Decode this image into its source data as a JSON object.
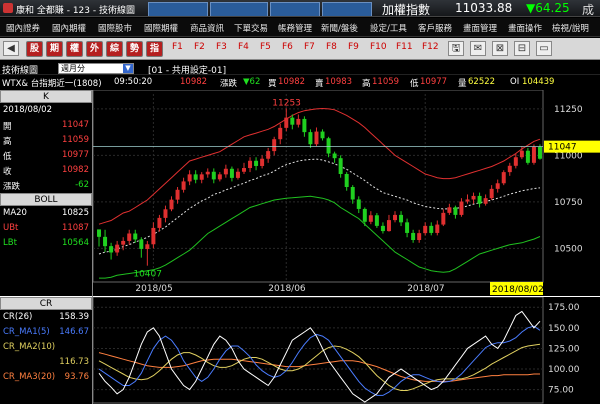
{
  "titlebar": {
    "app_title": "康和 全都賺 - 123 - 技術線圖",
    "tabs": [
      "",
      "",
      "",
      ""
    ],
    "index_name": "加權指數",
    "index_value": "11033.88",
    "index_change": "▼64.25",
    "more": "成交"
  },
  "menu": [
    "國內證券",
    "國內期權",
    "國際股市",
    "國際期權",
    "商品資訊",
    "下單交易",
    "帳務管理",
    "新聞/盤後",
    "設定/工具",
    "客戶服務",
    "畫面管理",
    "畫面操作",
    "檢視/說明"
  ],
  "toolbar": {
    "buttons": [
      "股",
      "期",
      "權",
      "外",
      "綜",
      "勢",
      "指"
    ],
    "functions": [
      "F1",
      "F2",
      "F3",
      "F4",
      "F5",
      "F6",
      "F7",
      "F8",
      "F9",
      "F10",
      "F11",
      "F12"
    ],
    "icons": [
      "🖫",
      "✉",
      "⊠",
      "⊟",
      "▭"
    ]
  },
  "chart_bar": {
    "title": "技術線圖",
    "period": "週月分",
    "setting": "[01 - 共用設定-01]"
  },
  "info": {
    "symbol": "WTX&  台指期近一(1808)",
    "time": "09:50:20",
    "last": "10982",
    "change_label": "漲跌",
    "change": "▼62",
    "open_label": "買",
    "open": "10982",
    "bid_label": "賣",
    "bid": "10983",
    "high_label": "高",
    "high": "11059",
    "low_label": "低",
    "low": "10977",
    "vol_label": "量",
    "vol": "62522",
    "oi_label": "OI",
    "oi": "104439"
  },
  "k_panel": {
    "header": "K",
    "date": "2018/08/02",
    "rows": [
      {
        "k": "開",
        "v": "11047"
      },
      {
        "k": "高",
        "v": "11059"
      },
      {
        "k": "低",
        "v": "10977"
      },
      {
        "k": "收",
        "v": "10982"
      },
      {
        "k": "漲跌",
        "v": "-62"
      }
    ]
  },
  "boll_panel": {
    "header": "BOLL",
    "rows": [
      {
        "k": "MA20",
        "v": "10825"
      },
      {
        "k": "UBt",
        "v": "11087"
      },
      {
        "k": "LBt",
        "v": "10564"
      }
    ]
  },
  "cr_panel": {
    "header": "CR",
    "rows": [
      {
        "k": "CR(26)",
        "v": "158.39"
      },
      {
        "k": "CR_MA1(5)",
        "v": "146.67"
      },
      {
        "k": "CR_MA2(10)",
        "v": "116.73"
      },
      {
        "k": "CR_MA3(20)",
        "v": "93.76"
      }
    ]
  },
  "colors": {
    "up": "#e03030",
    "down": "#20d020",
    "upper": "#e03030",
    "lower": "#20c020",
    "ma": "#e0e0e0",
    "cr": "#ffffff",
    "cr_ma1": "#4a7cff",
    "cr_ma2": "#e0d060",
    "cr_ma3": "#ff8040",
    "grid": "#333"
  },
  "chart_data": [
    {
      "type": "candlestick",
      "title": "WTX&",
      "yticks": [
        11250,
        11000,
        10750,
        10500
      ],
      "ylim": [
        10330,
        11330
      ],
      "xlabels": [
        "2018/05",
        "2018/06",
        "2018/07"
      ],
      "cursor_date": "2018/08/02",
      "last_value": "11047",
      "max_label": "11253",
      "min_label": "10407",
      "candles": [
        [
          10602,
          10562,
          10590,
          10510
        ],
        [
          10562,
          10512,
          10600,
          10480
        ],
        [
          10512,
          10478,
          10530,
          10440
        ],
        [
          10478,
          10520,
          10540,
          10460
        ],
        [
          10520,
          10540,
          10560,
          10490
        ],
        [
          10540,
          10580,
          10600,
          10520
        ],
        [
          10580,
          10548,
          10600,
          10530
        ],
        [
          10548,
          10497,
          10560,
          10450
        ],
        [
          10497,
          10522,
          10540,
          10407
        ],
        [
          10522,
          10610,
          10640,
          10500
        ],
        [
          10610,
          10664,
          10680,
          10590
        ],
        [
          10664,
          10710,
          10730,
          10640
        ],
        [
          10710,
          10762,
          10780,
          10700
        ],
        [
          10762,
          10815,
          10830,
          10740
        ],
        [
          10815,
          10860,
          10880,
          10800
        ],
        [
          10860,
          10898,
          10920,
          10840
        ],
        [
          10898,
          10869,
          10920,
          10850
        ],
        [
          10869,
          10898,
          10910,
          10850
        ],
        [
          10898,
          10912,
          10930,
          10880
        ],
        [
          10912,
          10871,
          10930,
          10850
        ],
        [
          10871,
          10898,
          10910,
          10860
        ],
        [
          10898,
          10928,
          10950,
          10880
        ],
        [
          10928,
          10879,
          10940,
          10860
        ],
        [
          10879,
          10912,
          10930,
          10870
        ],
        [
          10912,
          10932,
          10960,
          10900
        ],
        [
          10932,
          10971,
          10990,
          10910
        ],
        [
          10971,
          10943,
          10990,
          10920
        ],
        [
          10943,
          10982,
          11000,
          10930
        ],
        [
          10982,
          11023,
          11040,
          10960
        ],
        [
          11023,
          11087,
          11100,
          11000
        ],
        [
          11087,
          11148,
          11170,
          11060
        ],
        [
          11148,
          11203,
          11253,
          11130
        ],
        [
          11203,
          11165,
          11220,
          11140
        ],
        [
          11165,
          11196,
          11220,
          11150
        ],
        [
          11196,
          11125,
          11210,
          11100
        ],
        [
          11125,
          11060,
          11140,
          11040
        ],
        [
          11060,
          11128,
          11150,
          11050
        ],
        [
          11128,
          11092,
          11140,
          11080
        ],
        [
          11092,
          11010,
          11100,
          10990
        ],
        [
          11010,
          10985,
          11020,
          10960
        ],
        [
          10985,
          10900,
          11000,
          10880
        ],
        [
          10900,
          10830,
          10910,
          10810
        ],
        [
          10830,
          10763,
          10840,
          10740
        ],
        [
          10763,
          10712,
          10780,
          10690
        ],
        [
          10712,
          10643,
          10720,
          10620
        ],
        [
          10643,
          10678,
          10700,
          10630
        ],
        [
          10678,
          10621,
          10690,
          10610
        ],
        [
          10621,
          10593,
          10640,
          10580
        ],
        [
          10593,
          10652,
          10680,
          10590
        ],
        [
          10652,
          10680,
          10700,
          10640
        ],
        [
          10680,
          10640,
          10700,
          10620
        ],
        [
          10640,
          10583,
          10660,
          10560
        ],
        [
          10583,
          10545,
          10600,
          10530
        ],
        [
          10545,
          10582,
          10600,
          10530
        ],
        [
          10582,
          10621,
          10640,
          10570
        ],
        [
          10621,
          10583,
          10640,
          10570
        ],
        [
          10583,
          10628,
          10650,
          10570
        ],
        [
          10628,
          10691,
          10710,
          10620
        ],
        [
          10691,
          10721,
          10740,
          10680
        ],
        [
          10721,
          10680,
          10730,
          10660
        ],
        [
          10680,
          10752,
          10770,
          10670
        ],
        [
          10752,
          10763,
          10790,
          10740
        ],
        [
          10763,
          10782,
          10800,
          10740
        ],
        [
          10782,
          10740,
          10800,
          10720
        ],
        [
          10740,
          10770,
          10790,
          10730
        ],
        [
          10770,
          10820,
          10840,
          10760
        ],
        [
          10820,
          10850,
          10870,
          10800
        ],
        [
          10850,
          10910,
          10920,
          10840
        ],
        [
          10910,
          10944,
          10960,
          10890
        ],
        [
          10944,
          10990,
          11010,
          10930
        ],
        [
          10990,
          11025,
          11050,
          10980
        ],
        [
          11025,
          10960,
          11040,
          10950
        ],
        [
          10960,
          11047,
          11059,
          10950
        ],
        [
          11047,
          10982,
          11059,
          10977
        ]
      ],
      "ma": [
        10470,
        10480,
        10485,
        10495,
        10510,
        10520,
        10535,
        10545,
        10560,
        10575,
        10595,
        10615,
        10640,
        10665,
        10690,
        10715,
        10735,
        10755,
        10770,
        10790,
        10800,
        10815,
        10825,
        10840,
        10850,
        10865,
        10875,
        10890,
        10900,
        10915,
        10935,
        10950,
        10960,
        10970,
        10975,
        10978,
        10980,
        10975,
        10965,
        10955,
        10940,
        10925,
        10905,
        10885,
        10865,
        10840,
        10820,
        10800,
        10790,
        10780,
        10770,
        10760,
        10745,
        10735,
        10725,
        10720,
        10715,
        10712,
        10712,
        10715,
        10720,
        10728,
        10738,
        10745,
        10752,
        10760,
        10770,
        10780,
        10792,
        10800,
        10810,
        10815,
        10822,
        10825
      ],
      "upper": [
        10630,
        10640,
        10650,
        10670,
        10690,
        10700,
        10720,
        10740,
        10760,
        10790,
        10820,
        10850,
        10880,
        10910,
        10940,
        10970,
        10980,
        10990,
        11000,
        11010,
        11020,
        11040,
        11060,
        11080,
        11100,
        11110,
        11120,
        11130,
        11140,
        11155,
        11175,
        11195,
        11215,
        11230,
        11240,
        11245,
        11250,
        11252,
        11250,
        11245,
        11230,
        11215,
        11195,
        11175,
        11150,
        11120,
        11090,
        11060,
        11030,
        11000,
        10980,
        10960,
        10940,
        10920,
        10900,
        10890,
        10880,
        10875,
        10875,
        10880,
        10890,
        10900,
        10910,
        10920,
        10930,
        10940,
        10955,
        10970,
        10990,
        11010,
        11035,
        11055,
        11075,
        11087
      ],
      "lower": [
        10340,
        10340,
        10345,
        10355,
        10360,
        10365,
        10370,
        10375,
        10380,
        10385,
        10395,
        10410,
        10430,
        10450,
        10470,
        10490,
        10520,
        10550,
        10580,
        10600,
        10620,
        10640,
        10660,
        10680,
        10700,
        10720,
        10730,
        10740,
        10750,
        10760,
        10765,
        10770,
        10772,
        10775,
        10778,
        10780,
        10775,
        10770,
        10760,
        10745,
        10720,
        10700,
        10680,
        10660,
        10630,
        10600,
        10570,
        10540,
        10510,
        10480,
        10460,
        10440,
        10420,
        10400,
        10390,
        10380,
        10375,
        10372,
        10375,
        10390,
        10410,
        10430,
        10450,
        10470,
        10480,
        10490,
        10500,
        10510,
        10520,
        10525,
        10530,
        10540,
        10550,
        10564
      ]
    },
    {
      "type": "line",
      "title": "CR",
      "yticks": [
        175,
        150,
        125,
        100,
        75
      ],
      "ylim": [
        60,
        185
      ],
      "series": [
        {
          "name": "CR(26)",
          "color_key": "cr",
          "values": [
            95,
            85,
            78,
            70,
            75,
            90,
            110,
            130,
            145,
            150,
            140,
            120,
            100,
            90,
            80,
            75,
            85,
            100,
            115,
            130,
            140,
            135,
            125,
            110,
            100,
            95,
            90,
            85,
            80,
            90,
            105,
            120,
            135,
            140,
            145,
            150,
            140,
            125,
            110,
            100,
            90,
            80,
            70,
            65,
            60,
            65,
            70,
            80,
            90,
            95,
            100,
            95,
            90,
            85,
            80,
            75,
            78,
            85,
            95,
            105,
            115,
            125,
            130,
            135,
            140,
            130,
            125,
            135,
            150,
            165,
            170,
            160,
            150,
            158
          ]
        },
        {
          "name": "CR_MA1(5)",
          "color_key": "cr_ma1",
          "values": [
            100,
            95,
            90,
            85,
            80,
            80,
            85,
            95,
            110,
            125,
            135,
            140,
            135,
            125,
            110,
            100,
            90,
            85,
            90,
            100,
            112,
            122,
            128,
            128,
            122,
            115,
            105,
            98,
            93,
            90,
            92,
            98,
            108,
            120,
            130,
            138,
            142,
            140,
            135,
            125,
            115,
            105,
            95,
            85,
            77,
            72,
            68,
            68,
            72,
            78,
            85,
            90,
            93,
            93,
            90,
            87,
            85,
            84,
            85,
            88,
            94,
            102,
            110,
            118,
            126,
            130,
            132,
            132,
            134,
            138,
            145,
            150,
            152,
            147
          ]
        },
        {
          "name": "CR_MA2(10)",
          "color_key": "cr_ma2",
          "values": [
            110,
            106,
            102,
            98,
            94,
            90,
            88,
            87,
            88,
            92,
            98,
            105,
            112,
            117,
            120,
            120,
            117,
            113,
            108,
            104,
            102,
            102,
            104,
            108,
            112,
            114,
            114,
            112,
            108,
            104,
            100,
            98,
            98,
            100,
            104,
            110,
            116,
            122,
            126,
            128,
            127,
            124,
            120,
            115,
            108,
            100,
            92,
            86,
            80,
            76,
            74,
            74,
            76,
            79,
            82,
            85,
            87,
            88,
            88,
            88,
            88,
            90,
            93,
            97,
            101,
            106,
            110,
            114,
            118,
            122,
            126,
            128,
            129,
            130
          ]
        },
        {
          "name": "CR_MA3(20)",
          "color_key": "cr_ma3",
          "values": [
            120,
            118,
            116,
            114,
            112,
            110,
            108,
            106,
            104,
            103,
            102,
            102,
            102,
            103,
            104,
            106,
            108,
            110,
            111,
            112,
            112,
            112,
            112,
            111,
            110,
            109,
            108,
            107,
            106,
            105,
            104,
            103,
            103,
            103,
            104,
            105,
            106,
            107,
            108,
            109,
            110,
            110,
            110,
            109,
            107,
            105,
            103,
            100,
            97,
            94,
            91,
            89,
            87,
            86,
            85,
            85,
            85,
            85,
            85,
            86,
            87,
            88,
            89,
            90,
            91,
            92,
            92,
            93,
            93,
            93,
            93,
            93,
            94,
            94
          ]
        }
      ]
    }
  ]
}
